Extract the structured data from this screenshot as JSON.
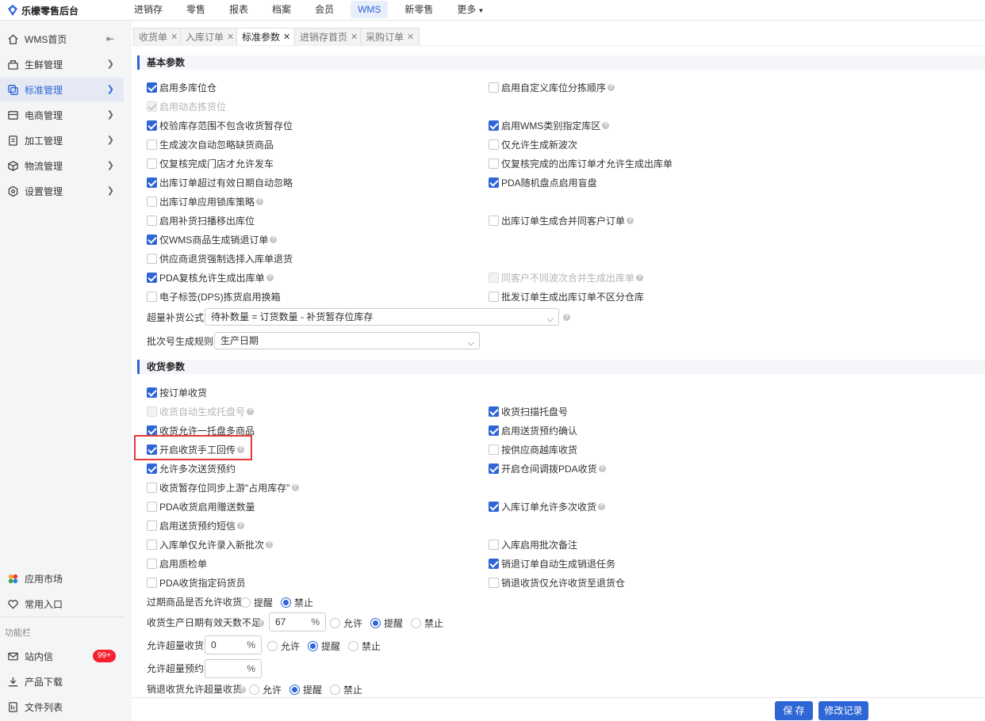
{
  "app": {
    "logo_text": "乐檬零售后台"
  },
  "topnav": [
    "进销存",
    "零售",
    "报表",
    "档案",
    "会员",
    "WMS",
    "新零售",
    "更多"
  ],
  "sidebar": {
    "items": [
      {
        "label": "WMS首页",
        "icon": "home-icon"
      },
      {
        "label": "生鲜管理",
        "icon": "fresh-icon"
      },
      {
        "label": "标准管理",
        "icon": "standard-icon"
      },
      {
        "label": "电商管理",
        "icon": "ecommerce-icon"
      },
      {
        "label": "加工管理",
        "icon": "process-icon"
      },
      {
        "label": "物流管理",
        "icon": "logistics-icon"
      },
      {
        "label": "设置管理",
        "icon": "settings-icon"
      }
    ],
    "bottom": {
      "app_market": "应用市场",
      "common_entry": "常用入口",
      "section": "功能栏",
      "inbox": "站内信",
      "inbox_badge": "99+",
      "download": "产品下载",
      "files": "文件列表"
    }
  },
  "tabs": [
    "收货单",
    "入库订单",
    "标准参数",
    "进销存首页",
    "采购订单"
  ],
  "basic": {
    "title": "基本参数",
    "options": [
      {
        "label": "启用多库位仓",
        "checked": true
      },
      {
        "label": "启用自定义库位分拣顺序",
        "checked": false
      },
      {
        "label": "启用动态拣货位",
        "checked": true
      },
      {
        "label": "校验库存范围不包含收货暂存位",
        "checked": true
      },
      {
        "label": "启用WMS类别指定库区",
        "checked": true
      },
      {
        "label": "生成波次自动忽略缺货商品",
        "checked": false
      },
      {
        "label": "仅允许生成新波次",
        "checked": false
      },
      {
        "label": "仅复核完成门店才允许发车",
        "checked": false
      },
      {
        "label": "仅复核完成的出库订单才允许生成出库单",
        "checked": false
      },
      {
        "label": "出库订单超过有效日期自动忽略",
        "checked": true
      },
      {
        "label": "PDA随机盘点启用盲盘",
        "checked": true
      },
      {
        "label": "出库订单应用锁库策略",
        "checked": false
      },
      {
        "label": "启用补货扫播移出库位",
        "checked": false
      },
      {
        "label": "出库订单生成合并同客户订单",
        "checked": false
      },
      {
        "label": "仅WMS商品生成销退订单",
        "checked": true
      },
      {
        "label": "供应商退货强制选择入库单退货",
        "checked": false
      },
      {
        "label": "PDA复核允许生成出库单",
        "checked": true
      },
      {
        "label": "同客户不同波次合并生成出库单",
        "checked": false
      },
      {
        "label": "电子标签(DPS)拣货启用换箱",
        "checked": false
      },
      {
        "label": "批发订单生成出库订单不区分仓库",
        "checked": false
      }
    ],
    "formula_label": "超量补货公式",
    "formula_value": "待补数量 = 订货数量 - 补货暂存位库存",
    "batch_label": "批次号生成规则",
    "batch_value": "生产日期"
  },
  "receive": {
    "title": "收货参数",
    "options": [
      {
        "label": "按订单收货",
        "checked": true
      },
      {
        "label": "收货自动生成托盘号",
        "checked": false
      },
      {
        "label": "收货扫描托盘号",
        "checked": true
      },
      {
        "label": "收货允许一托盘多商品",
        "checked": true
      },
      {
        "label": "启用送货预约确认",
        "checked": true
      },
      {
        "label": "开启收货手工回传",
        "checked": true
      },
      {
        "label": "按供应商越库收货",
        "checked": false
      },
      {
        "label": "允许多次送货预约",
        "checked": true
      },
      {
        "label": "开启仓间调拨PDA收货",
        "checked": true
      },
      {
        "label": "收货暂存位同步上游\"占用库存\"",
        "checked": false
      },
      {
        "label": "PDA收货启用赠送数量",
        "checked": false
      },
      {
        "label": "入库订单允许多次收货",
        "checked": true
      },
      {
        "label": "启用送货预约短信",
        "checked": false
      },
      {
        "label": "入库单仅允许录入新批次",
        "checked": false
      },
      {
        "label": "入库启用批次备注",
        "checked": false
      },
      {
        "label": "启用质检单",
        "checked": false
      },
      {
        "label": "销退订单自动生成销退任务",
        "checked": true
      },
      {
        "label": "PDA收货指定码货员",
        "checked": false
      },
      {
        "label": "销退收货仅允许收货至退货仓",
        "checked": false
      }
    ],
    "expire_label": "过期商品是否允许收货",
    "expire_options": [
      "提醒",
      "禁止"
    ],
    "expire_selected": "禁止",
    "prod_label": "收货生产日期有效天数不足",
    "prod_value": "67",
    "prod_options": [
      "允许",
      "提醒",
      "禁止"
    ],
    "prod_selected": "提醒",
    "over_label": "允许超量收货",
    "over_value": "0",
    "over_options": [
      "允许",
      "提醒",
      "禁止"
    ],
    "over_selected": "提醒",
    "over_appt_label": "允许超量预约",
    "over_appt_value": "",
    "return_label": "销退收货允许超量收货",
    "return_options": [
      "允许",
      "提醒",
      "禁止"
    ],
    "return_selected": "提醒",
    "pct": "%"
  },
  "buttons": {
    "save": "保 存",
    "history": "修改记录"
  }
}
